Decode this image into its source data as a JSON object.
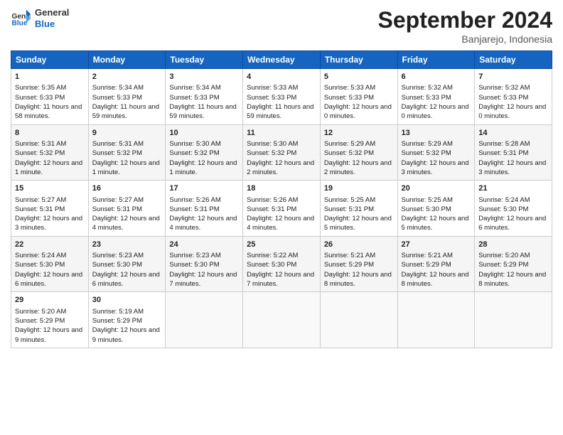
{
  "header": {
    "logo_general": "General",
    "logo_blue": "Blue",
    "month_title": "September 2024",
    "location": "Banjarejo, Indonesia"
  },
  "days_of_week": [
    "Sunday",
    "Monday",
    "Tuesday",
    "Wednesday",
    "Thursday",
    "Friday",
    "Saturday"
  ],
  "weeks": [
    [
      {
        "day": "1",
        "sunrise": "Sunrise: 5:35 AM",
        "sunset": "Sunset: 5:33 PM",
        "daylight": "Daylight: 11 hours and 58 minutes."
      },
      {
        "day": "2",
        "sunrise": "Sunrise: 5:34 AM",
        "sunset": "Sunset: 5:33 PM",
        "daylight": "Daylight: 11 hours and 59 minutes."
      },
      {
        "day": "3",
        "sunrise": "Sunrise: 5:34 AM",
        "sunset": "Sunset: 5:33 PM",
        "daylight": "Daylight: 11 hours and 59 minutes."
      },
      {
        "day": "4",
        "sunrise": "Sunrise: 5:33 AM",
        "sunset": "Sunset: 5:33 PM",
        "daylight": "Daylight: 11 hours and 59 minutes."
      },
      {
        "day": "5",
        "sunrise": "Sunrise: 5:33 AM",
        "sunset": "Sunset: 5:33 PM",
        "daylight": "Daylight: 12 hours and 0 minutes."
      },
      {
        "day": "6",
        "sunrise": "Sunrise: 5:32 AM",
        "sunset": "Sunset: 5:33 PM",
        "daylight": "Daylight: 12 hours and 0 minutes."
      },
      {
        "day": "7",
        "sunrise": "Sunrise: 5:32 AM",
        "sunset": "Sunset: 5:33 PM",
        "daylight": "Daylight: 12 hours and 0 minutes."
      }
    ],
    [
      {
        "day": "8",
        "sunrise": "Sunrise: 5:31 AM",
        "sunset": "Sunset: 5:32 PM",
        "daylight": "Daylight: 12 hours and 1 minute."
      },
      {
        "day": "9",
        "sunrise": "Sunrise: 5:31 AM",
        "sunset": "Sunset: 5:32 PM",
        "daylight": "Daylight: 12 hours and 1 minute."
      },
      {
        "day": "10",
        "sunrise": "Sunrise: 5:30 AM",
        "sunset": "Sunset: 5:32 PM",
        "daylight": "Daylight: 12 hours and 1 minute."
      },
      {
        "day": "11",
        "sunrise": "Sunrise: 5:30 AM",
        "sunset": "Sunset: 5:32 PM",
        "daylight": "Daylight: 12 hours and 2 minutes."
      },
      {
        "day": "12",
        "sunrise": "Sunrise: 5:29 AM",
        "sunset": "Sunset: 5:32 PM",
        "daylight": "Daylight: 12 hours and 2 minutes."
      },
      {
        "day": "13",
        "sunrise": "Sunrise: 5:29 AM",
        "sunset": "Sunset: 5:32 PM",
        "daylight": "Daylight: 12 hours and 3 minutes."
      },
      {
        "day": "14",
        "sunrise": "Sunrise: 5:28 AM",
        "sunset": "Sunset: 5:31 PM",
        "daylight": "Daylight: 12 hours and 3 minutes."
      }
    ],
    [
      {
        "day": "15",
        "sunrise": "Sunrise: 5:27 AM",
        "sunset": "Sunset: 5:31 PM",
        "daylight": "Daylight: 12 hours and 3 minutes."
      },
      {
        "day": "16",
        "sunrise": "Sunrise: 5:27 AM",
        "sunset": "Sunset: 5:31 PM",
        "daylight": "Daylight: 12 hours and 4 minutes."
      },
      {
        "day": "17",
        "sunrise": "Sunrise: 5:26 AM",
        "sunset": "Sunset: 5:31 PM",
        "daylight": "Daylight: 12 hours and 4 minutes."
      },
      {
        "day": "18",
        "sunrise": "Sunrise: 5:26 AM",
        "sunset": "Sunset: 5:31 PM",
        "daylight": "Daylight: 12 hours and 4 minutes."
      },
      {
        "day": "19",
        "sunrise": "Sunrise: 5:25 AM",
        "sunset": "Sunset: 5:31 PM",
        "daylight": "Daylight: 12 hours and 5 minutes."
      },
      {
        "day": "20",
        "sunrise": "Sunrise: 5:25 AM",
        "sunset": "Sunset: 5:30 PM",
        "daylight": "Daylight: 12 hours and 5 minutes."
      },
      {
        "day": "21",
        "sunrise": "Sunrise: 5:24 AM",
        "sunset": "Sunset: 5:30 PM",
        "daylight": "Daylight: 12 hours and 6 minutes."
      }
    ],
    [
      {
        "day": "22",
        "sunrise": "Sunrise: 5:24 AM",
        "sunset": "Sunset: 5:30 PM",
        "daylight": "Daylight: 12 hours and 6 minutes."
      },
      {
        "day": "23",
        "sunrise": "Sunrise: 5:23 AM",
        "sunset": "Sunset: 5:30 PM",
        "daylight": "Daylight: 12 hours and 6 minutes."
      },
      {
        "day": "24",
        "sunrise": "Sunrise: 5:23 AM",
        "sunset": "Sunset: 5:30 PM",
        "daylight": "Daylight: 12 hours and 7 minutes."
      },
      {
        "day": "25",
        "sunrise": "Sunrise: 5:22 AM",
        "sunset": "Sunset: 5:30 PM",
        "daylight": "Daylight: 12 hours and 7 minutes."
      },
      {
        "day": "26",
        "sunrise": "Sunrise: 5:21 AM",
        "sunset": "Sunset: 5:29 PM",
        "daylight": "Daylight: 12 hours and 8 minutes."
      },
      {
        "day": "27",
        "sunrise": "Sunrise: 5:21 AM",
        "sunset": "Sunset: 5:29 PM",
        "daylight": "Daylight: 12 hours and 8 minutes."
      },
      {
        "day": "28",
        "sunrise": "Sunrise: 5:20 AM",
        "sunset": "Sunset: 5:29 PM",
        "daylight": "Daylight: 12 hours and 8 minutes."
      }
    ],
    [
      {
        "day": "29",
        "sunrise": "Sunrise: 5:20 AM",
        "sunset": "Sunset: 5:29 PM",
        "daylight": "Daylight: 12 hours and 9 minutes."
      },
      {
        "day": "30",
        "sunrise": "Sunrise: 5:19 AM",
        "sunset": "Sunset: 5:29 PM",
        "daylight": "Daylight: 12 hours and 9 minutes."
      },
      null,
      null,
      null,
      null,
      null
    ]
  ]
}
